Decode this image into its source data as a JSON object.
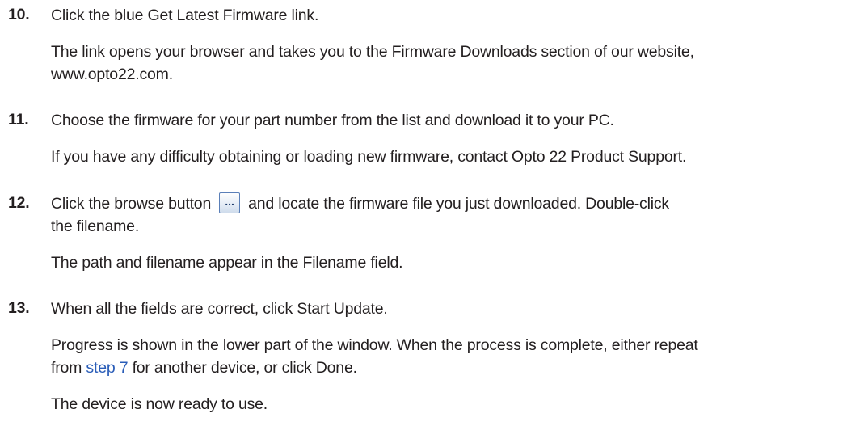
{
  "steps": [
    {
      "number": "10.",
      "instruction": "Click the blue Get Latest Firmware link.",
      "detail_line1": "The link opens your browser and takes you to the Firmware Downloads section of our website,",
      "detail_line2": "www.opto22.com."
    },
    {
      "number": "11.",
      "instruction": "Choose the firmware for your part number from the list and download it to your PC.",
      "detail": "If you have any difficulty obtaining or loading new firmware, contact Opto 22 Product Support."
    },
    {
      "number": "12.",
      "instruction_before": "Click the browse button",
      "browse_button_label": "...",
      "instruction_after": "and locate the firmware file you just downloaded. Double-click",
      "instruction_line2": "the filename.",
      "detail": "The path and filename appear in the Filename field."
    },
    {
      "number": "13.",
      "instruction": "When all the fields are correct, click Start Update.",
      "detail_line1": "Progress is shown in the lower part of the window. When the process is complete, either repeat",
      "detail_line2_before": "from",
      "detail_line2_link": "step 7",
      "detail_line2_after": "for another device, or click Done.",
      "detail_final": "The device is now ready to use."
    }
  ],
  "link_color": "#2a5db8",
  "text_color": "#231f20"
}
